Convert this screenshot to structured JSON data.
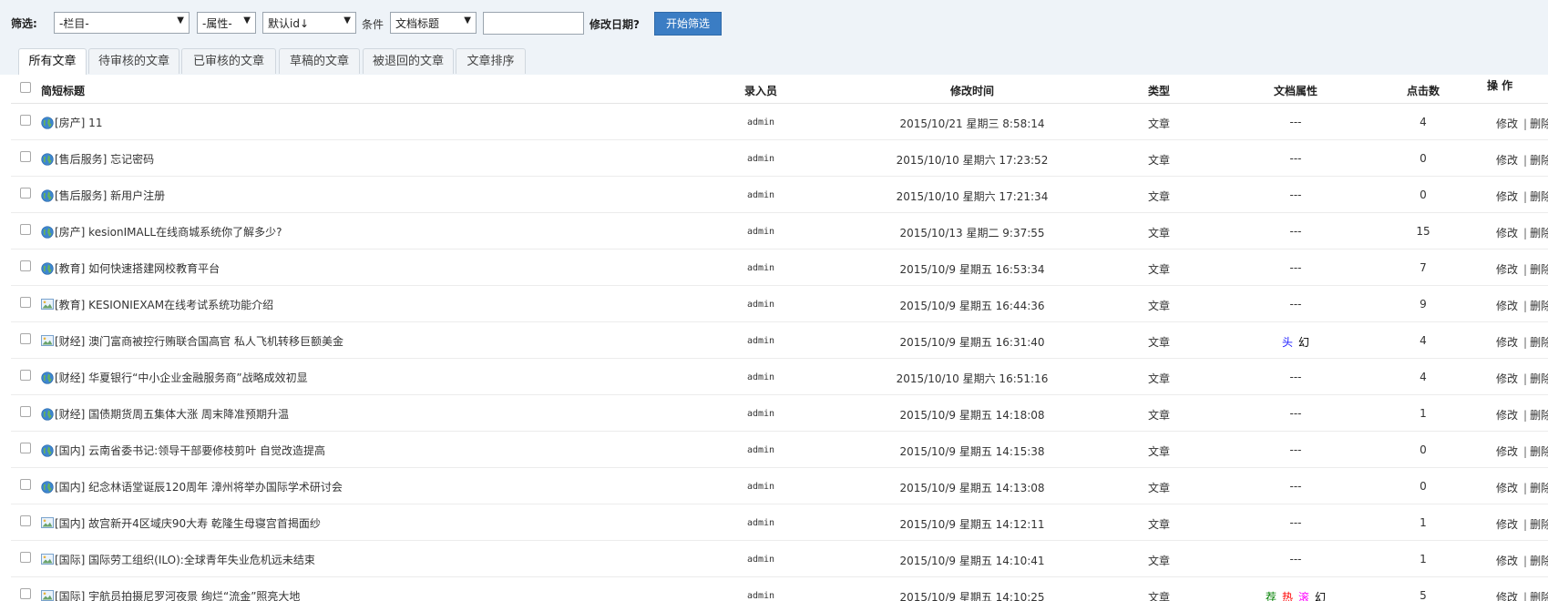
{
  "filter": {
    "label": "筛选:",
    "lanmu": "-栏目-",
    "attr": "-属性-",
    "order": "默认id↓",
    "condition_label": "条件",
    "field": "文档标题",
    "keyword": "",
    "date_label": "修改日期?",
    "button": "开始筛选",
    "arrow": "▼"
  },
  "tabs": [
    "所有文章",
    "待审核的文章",
    "已审核的文章",
    "草稿的文章",
    "被退回的文章",
    "文章排序"
  ],
  "headers": {
    "title": "简短标题",
    "author": "录入员",
    "time": "修改时间",
    "type": "类型",
    "attr": "文档属性",
    "hits": "点击数",
    "ops": "操 作"
  },
  "ops": {
    "edit": "修改",
    "sep": "|",
    "delete": "删除"
  },
  "colors": {
    "head": "#1a1aff",
    "huan": "#000000",
    "jian": "#008000",
    "re": "#ff0000",
    "gun": "#ff00ff"
  },
  "rows": [
    {
      "icon": "globe-icon",
      "title": "[房产] 11",
      "author": "admin",
      "time": "2015/10/21 星期三 8:58:14",
      "type": "文章",
      "attr": "---",
      "flags": [],
      "hits": "4"
    },
    {
      "icon": "globe-icon",
      "title": "[售后服务] 忘记密码",
      "author": "admin",
      "time": "2015/10/10 星期六 17:23:52",
      "type": "文章",
      "attr": "---",
      "flags": [],
      "hits": "0"
    },
    {
      "icon": "globe-icon",
      "title": "[售后服务] 新用户注册",
      "author": "admin",
      "time": "2015/10/10 星期六 17:21:34",
      "type": "文章",
      "attr": "---",
      "flags": [],
      "hits": "0"
    },
    {
      "icon": "globe-icon",
      "title": "[房产] kesionIMALL在线商城系统你了解多少?",
      "author": "admin",
      "time": "2015/10/13 星期二 9:37:55",
      "type": "文章",
      "attr": "---",
      "flags": [],
      "hits": "15"
    },
    {
      "icon": "globe-icon",
      "title": "[教育] 如何快速搭建网校教育平台",
      "author": "admin",
      "time": "2015/10/9 星期五 16:53:34",
      "type": "文章",
      "attr": "---",
      "flags": [],
      "hits": "7"
    },
    {
      "icon": "image-icon",
      "title": "[教育] KESIONIEXAM在线考试系统功能介绍",
      "author": "admin",
      "time": "2015/10/9 星期五 16:44:36",
      "type": "文章",
      "attr": "---",
      "flags": [],
      "hits": "9"
    },
    {
      "icon": "image-icon",
      "title": "[财经] 澳门富商被控行贿联合国高官 私人飞机转移巨额美金",
      "author": "admin",
      "time": "2015/10/9 星期五 16:31:40",
      "type": "文章",
      "attr": "",
      "flags": [
        {
          "text": "头",
          "color": "head"
        },
        {
          "text": "幻",
          "color": "huan"
        }
      ],
      "hits": "4"
    },
    {
      "icon": "globe-icon",
      "title": "[财经] 华夏银行“中小企业金融服务商”战略成效初显",
      "author": "admin",
      "time": "2015/10/10 星期六 16:51:16",
      "type": "文章",
      "attr": "---",
      "flags": [],
      "hits": "4"
    },
    {
      "icon": "globe-icon",
      "title": "[财经] 国债期货周五集体大涨 周末降准预期升温",
      "author": "admin",
      "time": "2015/10/9 星期五 14:18:08",
      "type": "文章",
      "attr": "---",
      "flags": [],
      "hits": "1"
    },
    {
      "icon": "globe-icon",
      "title": "[国内] 云南省委书记:领导干部要修枝剪叶 自觉改造提高",
      "author": "admin",
      "time": "2015/10/9 星期五 14:15:38",
      "type": "文章",
      "attr": "---",
      "flags": [],
      "hits": "0"
    },
    {
      "icon": "globe-icon",
      "title": "[国内] 纪念林语堂诞辰120周年 漳州将举办国际学术研讨会",
      "author": "admin",
      "time": "2015/10/9 星期五 14:13:08",
      "type": "文章",
      "attr": "---",
      "flags": [],
      "hits": "0"
    },
    {
      "icon": "image-icon",
      "title": "[国内] 故宫新开4区域庆90大寿 乾隆生母寝宫首揭面纱",
      "author": "admin",
      "time": "2015/10/9 星期五 14:12:11",
      "type": "文章",
      "attr": "---",
      "flags": [],
      "hits": "1"
    },
    {
      "icon": "image-icon",
      "title": "[国际] 国际劳工组织(ILO):全球青年失业危机远未结束",
      "author": "admin",
      "time": "2015/10/9 星期五 14:10:41",
      "type": "文章",
      "attr": "---",
      "flags": [],
      "hits": "1"
    },
    {
      "icon": "image-icon",
      "title": "[国际] 宇航员拍摄尼罗河夜景 绚烂“流金”照亮大地",
      "author": "admin",
      "time": "2015/10/9 星期五 14:10:25",
      "type": "文章",
      "attr": "",
      "flags": [
        {
          "text": "荐",
          "color": "jian"
        },
        {
          "text": "热",
          "color": "re"
        },
        {
          "text": "滚",
          "color": "gun"
        },
        {
          "text": "幻",
          "color": "huan"
        }
      ],
      "hits": "5"
    }
  ]
}
